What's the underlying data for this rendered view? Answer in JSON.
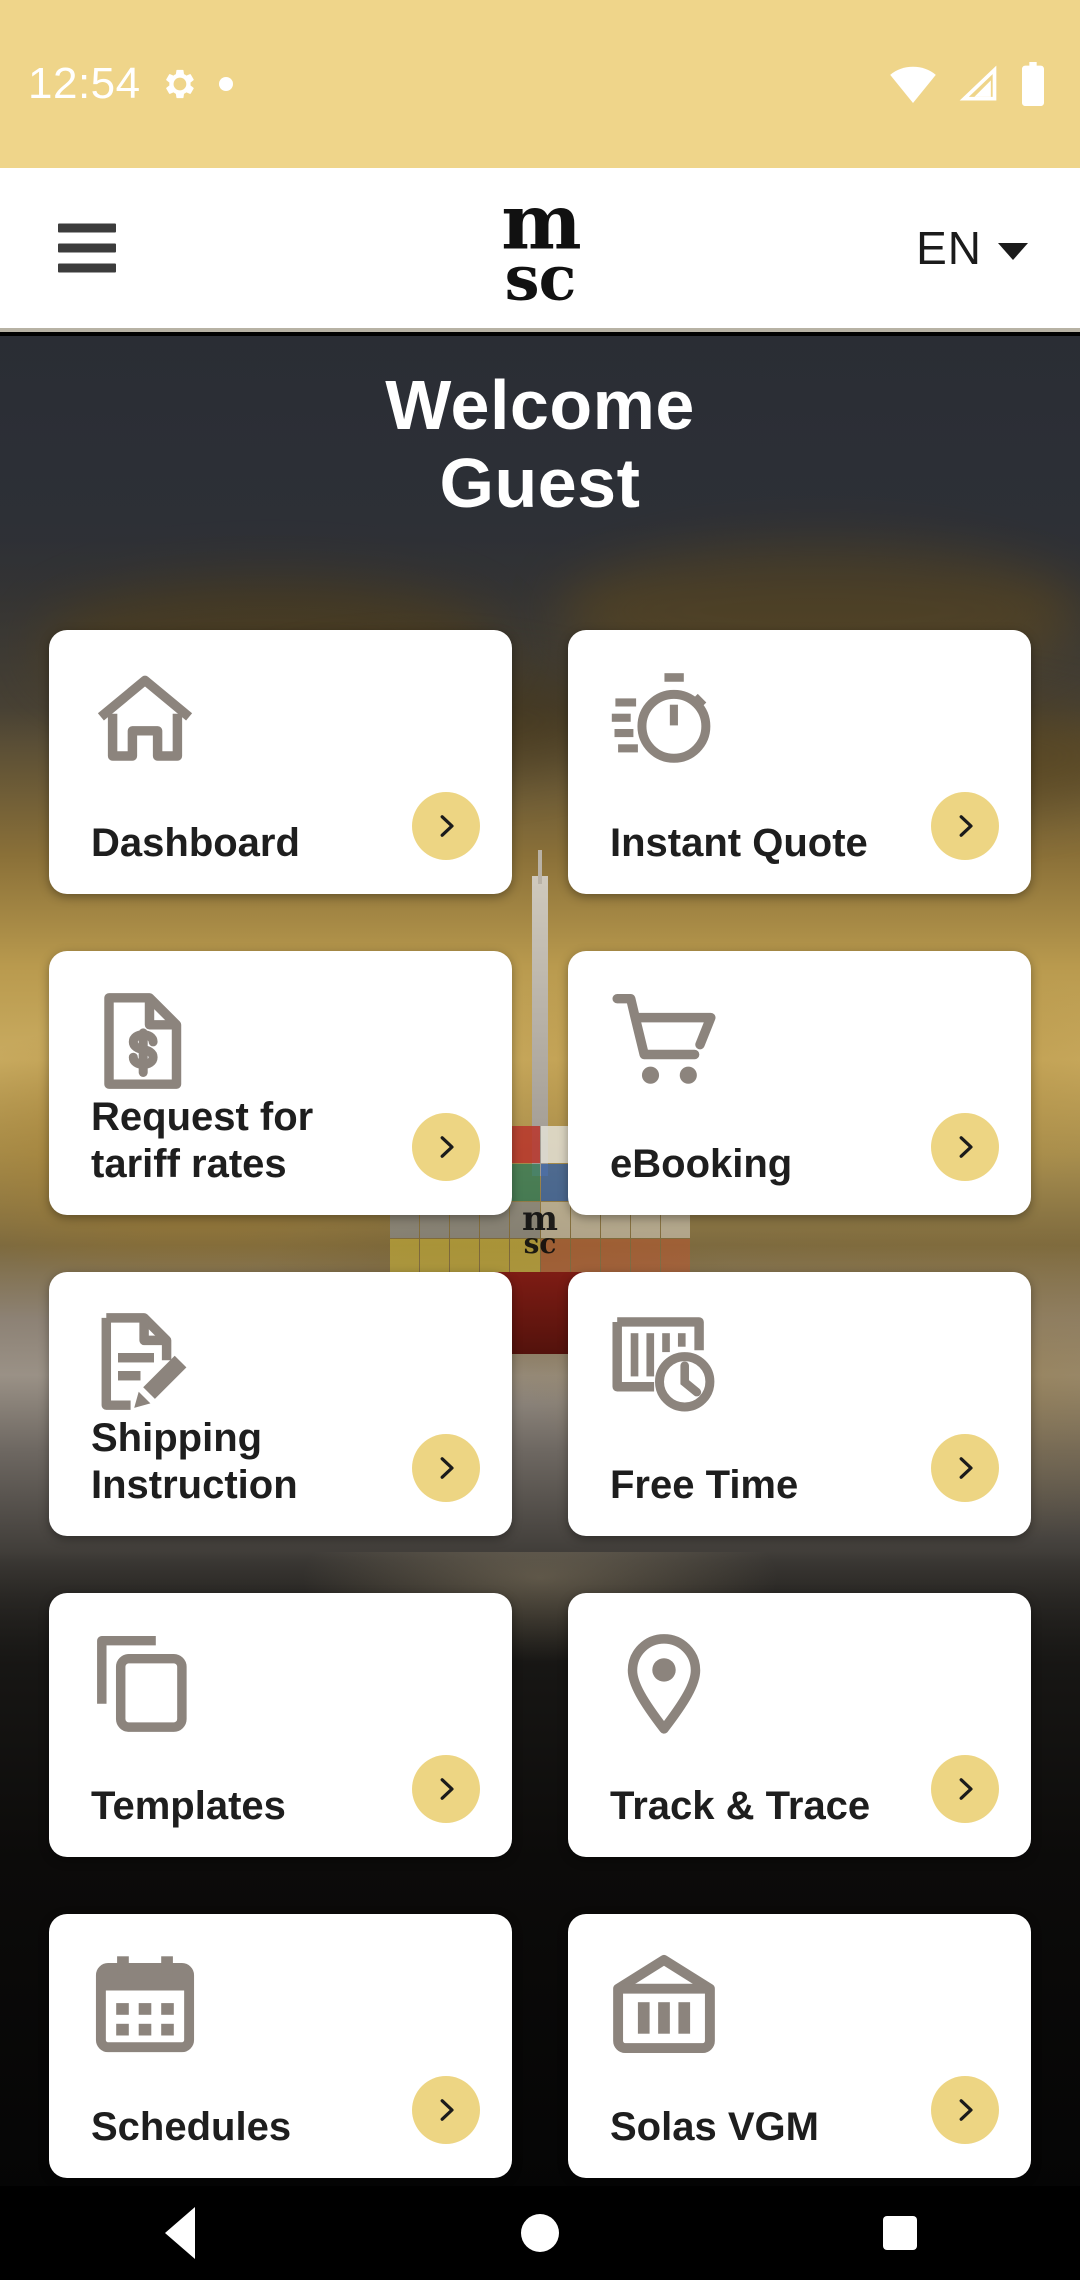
{
  "status_bar": {
    "time": "12:54",
    "icons": [
      "gear-icon",
      "dot-indicator",
      "wifi-icon",
      "cellular-signal-icon",
      "battery-icon"
    ],
    "background_color": "#EFD58A"
  },
  "app_bar": {
    "menu_icon": "hamburger-menu-icon",
    "logo_line1": "m",
    "logo_line2": "sc",
    "language": "EN",
    "language_chevron": "chevron-down-icon"
  },
  "hero": {
    "welcome_line1": "Welcome",
    "welcome_line2": "Guest",
    "background_description": "container-ship-at-sunset"
  },
  "tiles": [
    {
      "label": "Dashboard",
      "icon": "home-icon",
      "arrow": "chevron-right-icon"
    },
    {
      "label": "Instant Quote",
      "icon": "stopwatch-icon",
      "arrow": "chevron-right-icon"
    },
    {
      "label": "Request for tariff rates",
      "icon": "document-dollar-icon",
      "arrow": "chevron-right-icon"
    },
    {
      "label": "eBooking",
      "icon": "shopping-cart-icon",
      "arrow": "chevron-right-icon"
    },
    {
      "label": "Shipping Instruction",
      "icon": "document-edit-icon",
      "arrow": "chevron-right-icon"
    },
    {
      "label": "Free Time",
      "icon": "container-clock-icon",
      "arrow": "chevron-right-icon"
    },
    {
      "label": "Templates",
      "icon": "copy-icon",
      "arrow": "chevron-right-icon"
    },
    {
      "label": "Track & Trace",
      "icon": "location-pin-icon",
      "arrow": "chevron-right-icon"
    },
    {
      "label": "Schedules",
      "icon": "calendar-icon",
      "arrow": "chevron-right-icon"
    },
    {
      "label": "Solas VGM",
      "icon": "weighing-container-icon",
      "arrow": "chevron-right-icon"
    }
  ],
  "nav_bar": {
    "back": "back-triangle-icon",
    "home": "home-circle-icon",
    "recents": "recents-square-icon"
  },
  "colors": {
    "accent_gold": "#EDD583",
    "status_bar": "#EFD58A",
    "icon_gray": "#8C847D",
    "text_dark": "#1e1e1e",
    "card_white": "#ffffff"
  }
}
